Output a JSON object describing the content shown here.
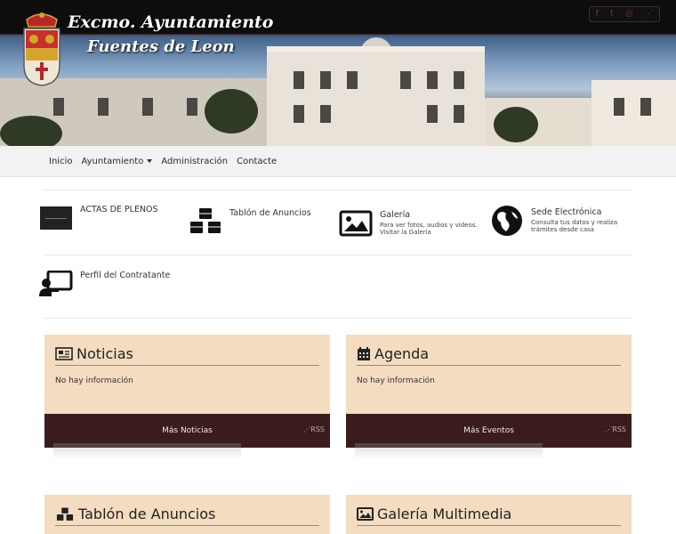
{
  "header": {
    "title_line1": "Excmo. Ayuntamiento",
    "title_line2": "Fuentes de Leon",
    "social_icons": [
      "facebook-icon",
      "twitter-icon",
      "instagram-icon",
      "rss-icon"
    ],
    "social_glyphs": [
      "f",
      "t",
      "◎",
      "⋰"
    ]
  },
  "nav": {
    "items": [
      {
        "label": "Inicio",
        "dropdown": false
      },
      {
        "label": "Ayuntamiento",
        "dropdown": true
      },
      {
        "label": "Administración",
        "dropdown": false
      },
      {
        "label": "Contacte",
        "dropdown": false
      }
    ]
  },
  "quick_links": [
    {
      "title": "ACTAS DE PLENOS",
      "subtitle": "",
      "icon": "actas-image"
    },
    {
      "title": "Tablón de Anuncios",
      "subtitle": "",
      "icon": "cubes-icon"
    },
    {
      "title": "Galería",
      "subtitle": "Para ver fotos, audios y videos. Visitar la Galería",
      "icon": "image-icon"
    },
    {
      "title": "Sede Electrónica",
      "subtitle": "Consulta tus datos y realiza trámites desde casa",
      "icon": "globe-icon"
    },
    {
      "title": "Perfil del Contratante",
      "subtitle": "",
      "icon": "presenter-icon"
    }
  ],
  "panels": [
    {
      "title": "Noticias",
      "body": "No hay información",
      "more": "Más Noticias",
      "rss": "RSS",
      "icon": "newspaper-icon"
    },
    {
      "title": "Agenda",
      "body": "No hay información",
      "more": "Más Eventos",
      "rss": "RSS",
      "icon": "calendar-icon"
    },
    {
      "title": "Tablón de Anuncios",
      "icon": "cubes-icon"
    },
    {
      "title": "Galería Multimedia",
      "icon": "image-icon"
    }
  ],
  "colors": {
    "panel_bg": "#f4dcc0",
    "panel_footer": "#3b1c1e",
    "nav_bg": "#f2f2f2"
  }
}
